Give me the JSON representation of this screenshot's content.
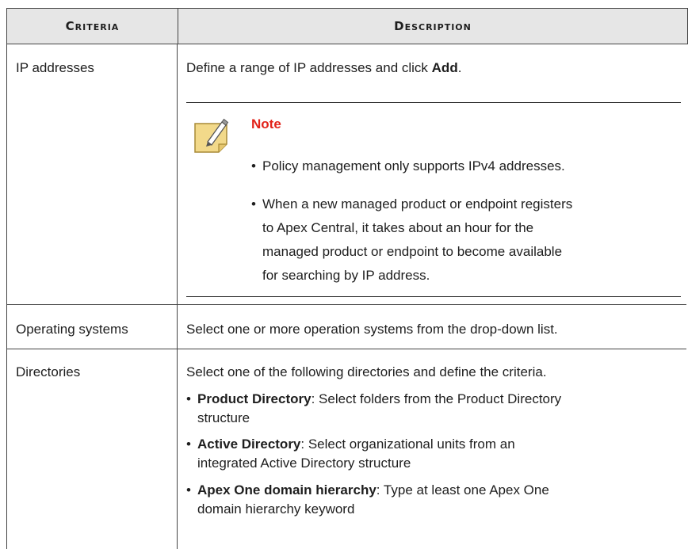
{
  "table": {
    "headers": {
      "criteria": "Criteria",
      "description": "Description"
    },
    "rows": [
      {
        "criteria": "IP addresses",
        "desc_prefix": "Define a range of IP addresses and click ",
        "desc_bold": "Add",
        "desc_suffix": ".",
        "note": {
          "title": "Note",
          "bullets": [
            [
              "Policy management only supports IPv4 addresses."
            ],
            [
              "When a new managed product or endpoint registers",
              "to Apex Central, it takes about an hour for the",
              "managed product or endpoint to become available",
              "for searching by IP address."
            ]
          ]
        }
      },
      {
        "criteria": "Operating systems",
        "desc": "Select one or more operation systems from the drop-down list."
      },
      {
        "criteria": "Directories",
        "desc": "Select one of the following directories and define the criteria.",
        "items": [
          {
            "bold": "Product Directory",
            "rest": ": Select folders from the Product Directory",
            "cont": "structure"
          },
          {
            "bold": "Active Directory",
            "rest": ": Select organizational units from an",
            "cont": "integrated Active Directory structure"
          },
          {
            "bold": "Apex One domain hierarchy",
            "rest": ": Type at least one Apex One",
            "cont": "domain hierarchy keyword"
          }
        ]
      }
    ]
  },
  "colors": {
    "header_bg": "#e6e6e6",
    "note_title": "#e2231a",
    "note_icon": "#f2d98a"
  },
  "icons": {
    "note": "note-pencil-icon"
  }
}
